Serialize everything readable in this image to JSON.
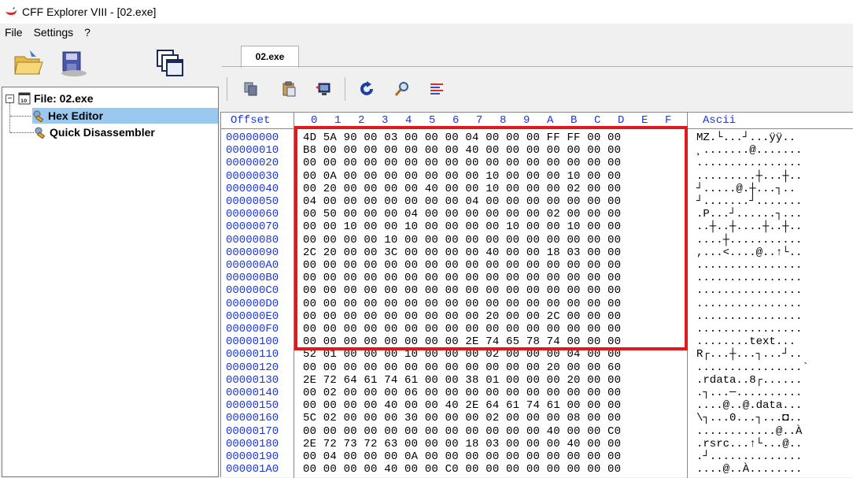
{
  "window": {
    "title": "CFF Explorer VIII - [02.exe]"
  },
  "menu": [
    "File",
    "Settings",
    "?"
  ],
  "tree": {
    "root": "File: 02.exe",
    "items": [
      "Hex Editor",
      "Quick Disassembler"
    ],
    "selected": "Hex Editor"
  },
  "tabs": [
    "02.exe"
  ],
  "hex": {
    "offset_header": "Offset",
    "column_headers": [
      "0",
      "1",
      "2",
      "3",
      "4",
      "5",
      "6",
      "7",
      "8",
      "9",
      "A",
      "B",
      "C",
      "D",
      "E",
      "F"
    ],
    "ascii_header": "Ascii",
    "rows": [
      {
        "offset": "00000000",
        "bytes": "4D 5A 90 00 03 00 00 00 04 00 00 00 FF FF 00 00",
        "ascii": "MZ.└...┘...ÿÿ.."
      },
      {
        "offset": "00000010",
        "bytes": "B8 00 00 00 00 00 00 00 40 00 00 00 00 00 00 00",
        "ascii": "¸.......@......."
      },
      {
        "offset": "00000020",
        "bytes": "00 00 00 00 00 00 00 00 00 00 00 00 00 00 00 00",
        "ascii": "................"
      },
      {
        "offset": "00000030",
        "bytes": "00 0A 00 00 00 00 00 00 00 10 00 00 00 10 00 00",
        "ascii": ".........┼...┼.."
      },
      {
        "offset": "00000040",
        "bytes": "00 20 00 00 00 00 40 00 00 10 00 00 00 02 00 00",
        "ascii": "┘.....@.┼...┐.."
      },
      {
        "offset": "00000050",
        "bytes": "04 00 00 00 00 00 00 00 04 00 00 00 00 00 00 00",
        "ascii": "┘.......┘......."
      },
      {
        "offset": "00000060",
        "bytes": "00 50 00 00 00 04 00 00 00 00 00 00 02 00 00 00",
        "ascii": ".P...┘......┐..."
      },
      {
        "offset": "00000070",
        "bytes": "00 00 10 00 00 10 00 00 00 00 10 00 00 10 00 00",
        "ascii": "..┼..┼....┼..┼.."
      },
      {
        "offset": "00000080",
        "bytes": "00 00 00 00 10 00 00 00 00 00 00 00 00 00 00 00",
        "ascii": "....┼..........."
      },
      {
        "offset": "00000090",
        "bytes": "2C 20 00 00 3C 00 00 00 00 40 00 00 18 03 00 00",
        "ascii": ",...<....@..↑└.."
      },
      {
        "offset": "000000A0",
        "bytes": "00 00 00 00 00 00 00 00 00 00 00 00 00 00 00 00",
        "ascii": "................"
      },
      {
        "offset": "000000B0",
        "bytes": "00 00 00 00 00 00 00 00 00 00 00 00 00 00 00 00",
        "ascii": "................"
      },
      {
        "offset": "000000C0",
        "bytes": "00 00 00 00 00 00 00 00 00 00 00 00 00 00 00 00",
        "ascii": "................"
      },
      {
        "offset": "000000D0",
        "bytes": "00 00 00 00 00 00 00 00 00 00 00 00 00 00 00 00",
        "ascii": "................"
      },
      {
        "offset": "000000E0",
        "bytes": "00 00 00 00 00 00 00 00 00 20 00 00 2C 00 00 00",
        "ascii": "................"
      },
      {
        "offset": "000000F0",
        "bytes": "00 00 00 00 00 00 00 00 00 00 00 00 00 00 00 00",
        "ascii": "................"
      },
      {
        "offset": "00000100",
        "bytes": "00 00 00 00 00 00 00 00 2E 74 65 78 74 00 00 00",
        "ascii": "........text..."
      },
      {
        "offset": "00000110",
        "bytes": "52 01 00 00 00 10 00 00 00 02 00 00 00 04 00 00",
        "ascii": "R┌...┼...┐...┘.."
      },
      {
        "offset": "00000120",
        "bytes": "00 00 00 00 00 00 00 00 00 00 00 00 20 00 00 60",
        "ascii": "................`"
      },
      {
        "offset": "00000130",
        "bytes": "2E 72 64 61 74 61 00 00 38 01 00 00 00 20 00 00",
        "ascii": ".rdata..8┌......"
      },
      {
        "offset": "00000140",
        "bytes": "00 02 00 00 00 06 00 00 00 00 00 00 00 00 00 00",
        "ascii": ".┐...─.........."
      },
      {
        "offset": "00000150",
        "bytes": "00 00 00 00 40 00 00 40 2E 64 61 74 61 00 00 00",
        "ascii": "....@..@.data..."
      },
      {
        "offset": "00000160",
        "bytes": "5C 02 00 00 00 30 00 00 00 02 00 00 00 08 00 00",
        "ascii": "\\┐...0...┐...◘.."
      },
      {
        "offset": "00000170",
        "bytes": "00 00 00 00 00 00 00 00 00 00 00 00 40 00 00 C0",
        "ascii": "............@..À"
      },
      {
        "offset": "00000180",
        "bytes": "2E 72 73 72 63 00 00 00 18 03 00 00 00 40 00 00",
        "ascii": ".rsrc...↑└...@.."
      },
      {
        "offset": "00000190",
        "bytes": "00 04 00 00 00 0A 00 00 00 00 00 00 00 00 00 00",
        "ascii": ".┘.............."
      },
      {
        "offset": "000001A0",
        "bytes": "00 00 00 00 40 00 00 C0 00 00 00 00 00 00 00 00",
        "ascii": "....@..À........"
      }
    ]
  },
  "colors": {
    "offset_blue": "#1a36e6",
    "highlight_red": "#e0191c",
    "selection": "#99c9ef"
  }
}
